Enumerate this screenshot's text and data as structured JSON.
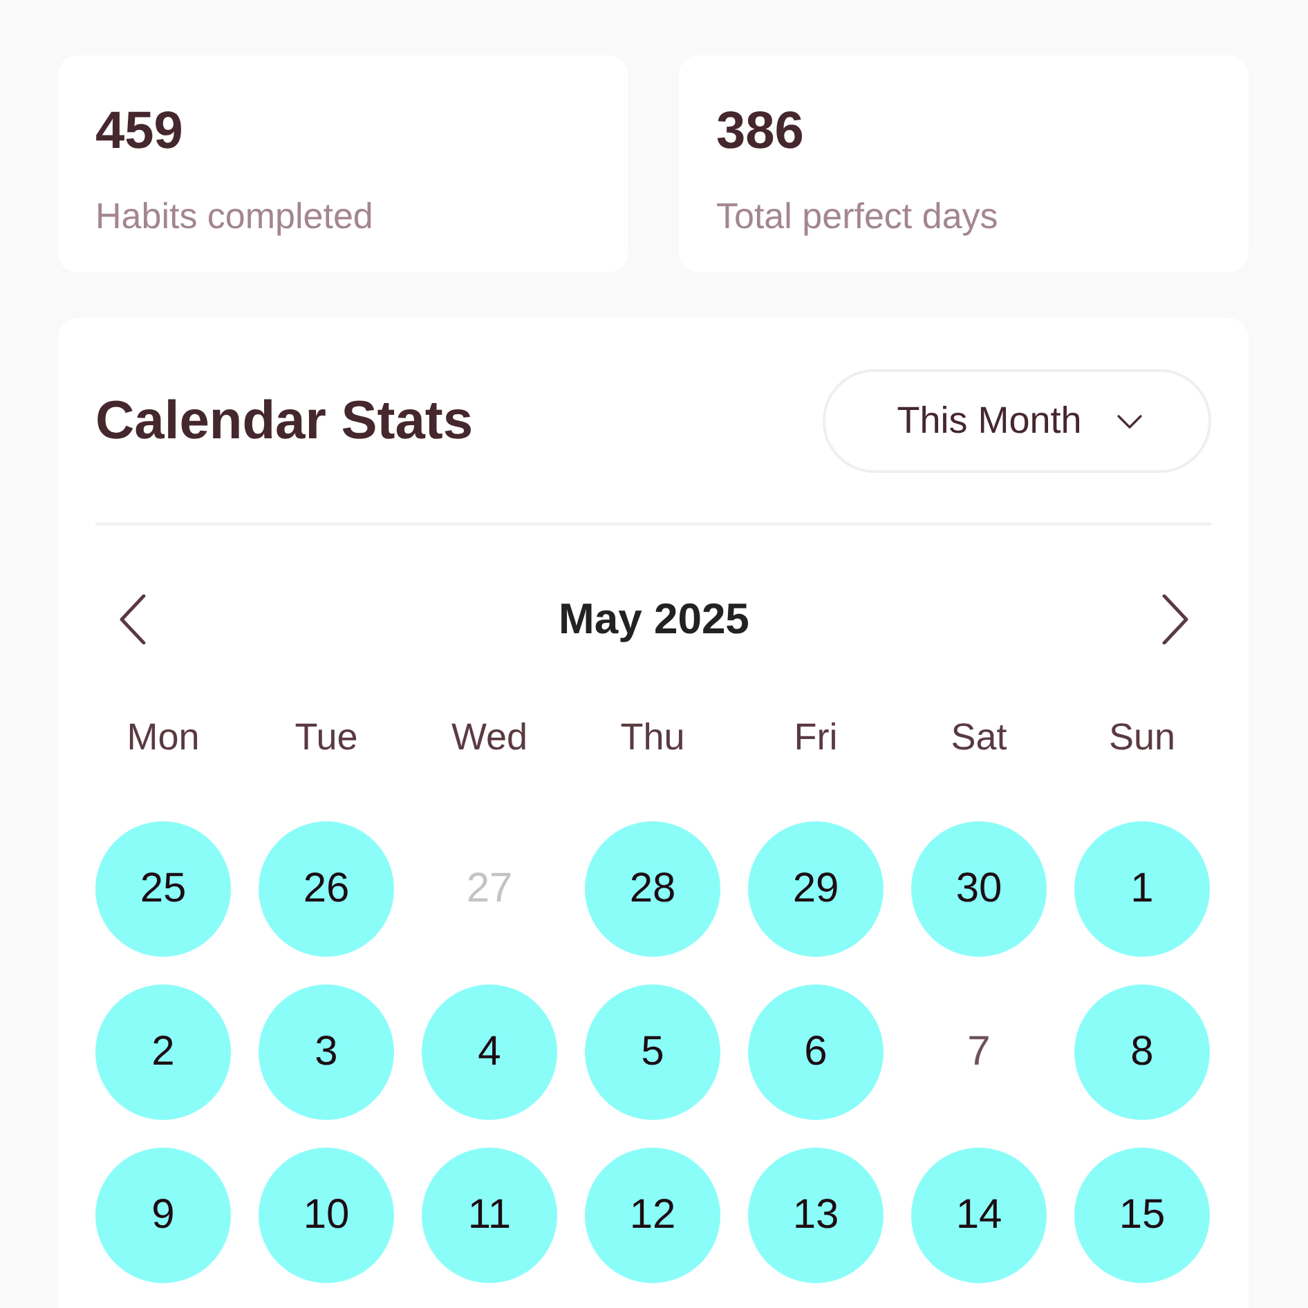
{
  "stats": [
    {
      "value": "459",
      "label": "Habits completed"
    },
    {
      "value": "386",
      "label": "Total perfect days"
    }
  ],
  "calendar": {
    "title": "Calendar Stats",
    "range_dropdown": {
      "value": "This Month"
    },
    "month": "May 2025",
    "weekdays": [
      "Mon",
      "Tue",
      "Wed",
      "Thu",
      "Fri",
      "Sat",
      "Sun"
    ],
    "weeks": [
      [
        {
          "day": "25",
          "completed": true,
          "dimmed": false
        },
        {
          "day": "26",
          "completed": true,
          "dimmed": false
        },
        {
          "day": "27",
          "completed": false,
          "dimmed": true
        },
        {
          "day": "28",
          "completed": true,
          "dimmed": false
        },
        {
          "day": "29",
          "completed": true,
          "dimmed": false
        },
        {
          "day": "30",
          "completed": true,
          "dimmed": false
        },
        {
          "day": "1",
          "completed": true,
          "dimmed": false
        }
      ],
      [
        {
          "day": "2",
          "completed": true,
          "dimmed": false
        },
        {
          "day": "3",
          "completed": true,
          "dimmed": false
        },
        {
          "day": "4",
          "completed": true,
          "dimmed": false
        },
        {
          "day": "5",
          "completed": true,
          "dimmed": false
        },
        {
          "day": "6",
          "completed": true,
          "dimmed": false
        },
        {
          "day": "7",
          "completed": false,
          "dimmed": false
        },
        {
          "day": "8",
          "completed": true,
          "dimmed": false
        }
      ],
      [
        {
          "day": "9",
          "completed": true,
          "dimmed": false
        },
        {
          "day": "10",
          "completed": true,
          "dimmed": false
        },
        {
          "day": "11",
          "completed": true,
          "dimmed": false
        },
        {
          "day": "12",
          "completed": true,
          "dimmed": false
        },
        {
          "day": "13",
          "completed": true,
          "dimmed": false
        },
        {
          "day": "14",
          "completed": true,
          "dimmed": false
        },
        {
          "day": "15",
          "completed": true,
          "dimmed": false
        }
      ]
    ]
  }
}
